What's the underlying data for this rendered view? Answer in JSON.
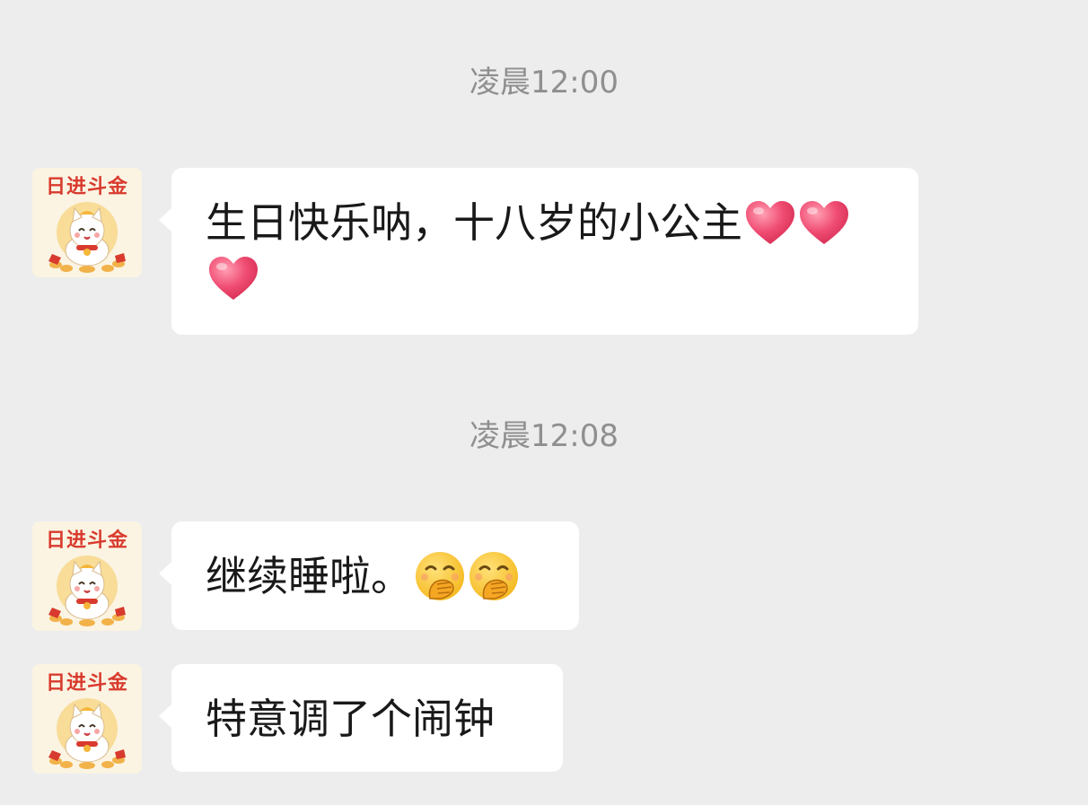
{
  "chat": {
    "timestamps": [
      "凌晨12:00",
      "凌晨12:08"
    ],
    "avatar": {
      "banner_text": "日进斗金",
      "icon": "lucky-cat-icon"
    },
    "messages": [
      {
        "text": "生日快乐呐，十八岁的小公主",
        "emojis": [
          "heart-emoji",
          "heart-emoji",
          "heart-emoji"
        ]
      },
      {
        "text": "继续睡啦。",
        "emojis": [
          "face-with-hand-over-mouth-emoji",
          "face-with-hand-over-mouth-emoji"
        ]
      },
      {
        "text": "特意调了个闹钟",
        "emojis": []
      }
    ]
  },
  "colors": {
    "background": "#ededed",
    "bubble": "#ffffff",
    "timestamp": "#8f8f8f",
    "heart": "#f04d73",
    "avatar_banner": "#d83b2e"
  }
}
